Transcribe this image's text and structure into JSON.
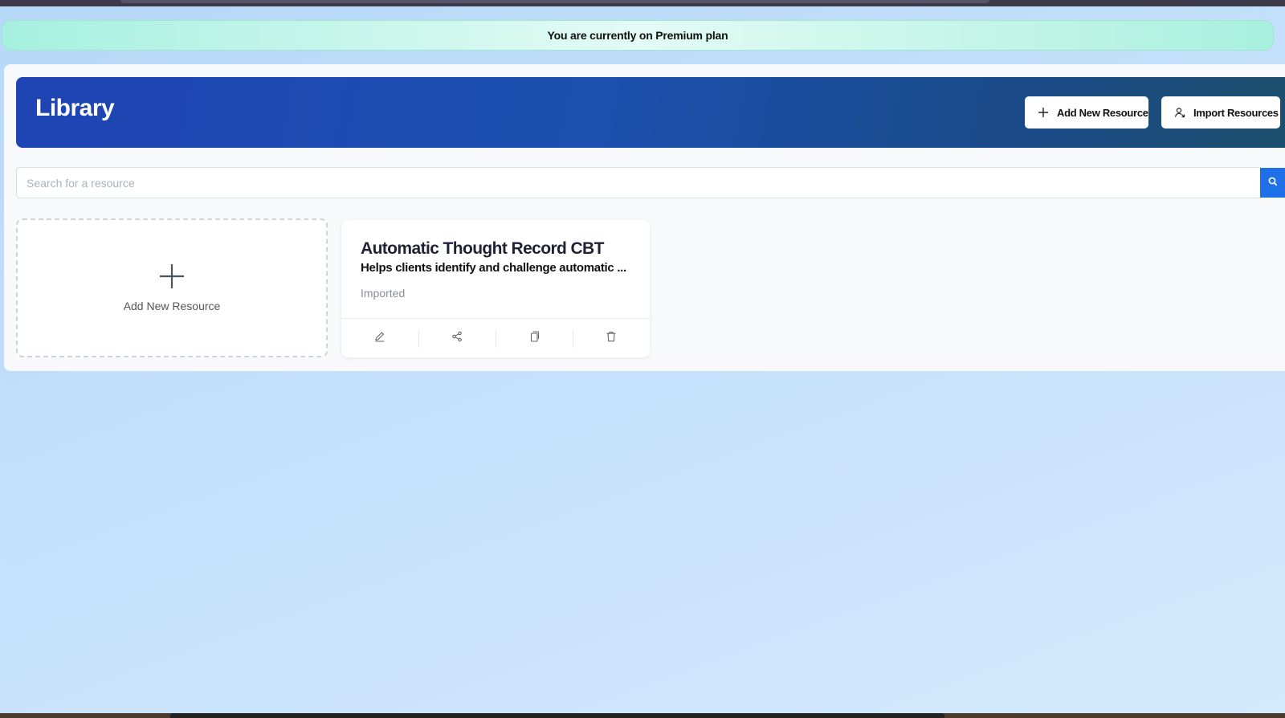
{
  "banner": {
    "text": "You are currently on Premium plan"
  },
  "header": {
    "title": "Library",
    "add_button_label": "Add New Resource",
    "import_button_label": "Import Resources",
    "gradient_colors": [
      "#1f44b4",
      "#1c4f6e"
    ]
  },
  "search": {
    "placeholder": "Search for a resource",
    "value": "",
    "button_color": "#1e6fe8"
  },
  "add_card": {
    "label": "Add New Resource",
    "icon": "plus-icon"
  },
  "resources": [
    {
      "title": "Automatic Thought Record CBT",
      "description": "Helps clients identify and challenge automatic ...",
      "status": "Imported",
      "actions": [
        "edit-icon",
        "share-icon",
        "copy-icon",
        "delete-icon"
      ]
    }
  ]
}
